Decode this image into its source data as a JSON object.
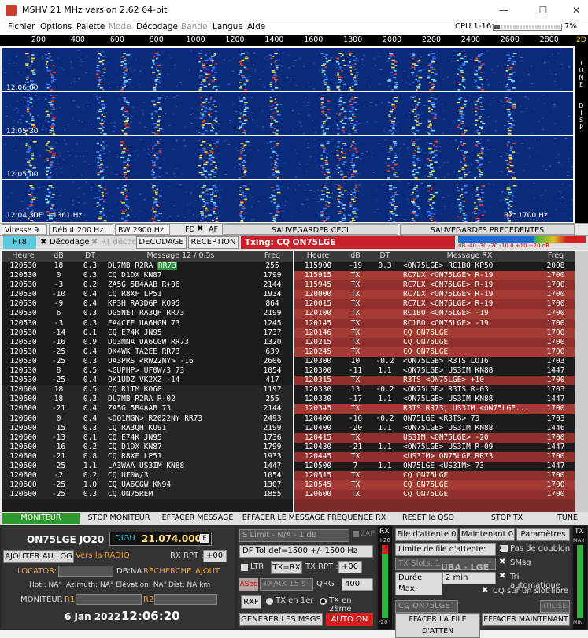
{
  "window": {
    "title": "MSHV 21 MHz version 2.62 64-bit",
    "minimize": "—",
    "maximize": "☐",
    "close": "✕"
  },
  "menu": {
    "items": [
      "Fichier",
      "Options",
      "Palette",
      "Mode",
      "Décodage",
      "Bande",
      "Langue",
      "Aide"
    ],
    "disabled": [
      "Mode",
      "Bande"
    ],
    "cpu_label": "CPU 1-16:",
    "cpu_value": "7%",
    "cpu_fraction": 0.07
  },
  "scale": {
    "ticks": [
      "200",
      "400",
      "600",
      "800",
      "1000",
      "1200",
      "1400",
      "1600",
      "1800",
      "2000",
      "2200",
      "2400",
      "2600",
      "2800",
      "3000"
    ],
    "side": "2D",
    "side_labels": [
      "T",
      "U",
      "N",
      "E",
      "D",
      "I",
      "S",
      "P"
    ]
  },
  "spectro": {
    "times": [
      "12:06:00",
      "12:05:30",
      "12:05:00",
      "12:04:30"
    ],
    "df": "DF: +1361 Hz",
    "rx": "RX: 1700 Hz"
  },
  "controls": {
    "vitesse": "Vitesse 9",
    "debut": "Début 200 Hz",
    "bw": "BW 2900 Hz",
    "fd": "FD",
    "af": "AF",
    "save_this": "SAUVEGARDER CECI",
    "save_prev": "SAUVEGARDES PRECEDENTES"
  },
  "modes": {
    "mode": "FT8",
    "decode_check": "Décodage",
    "rt": "RT décoc",
    "decodage": "DECODAGE",
    "reception": "RECEPTION",
    "txing": "Txing: CQ ON75LGE",
    "meter": "dB -40 -30 -20 -10 0 +10 +20 dB"
  },
  "left": {
    "headers": [
      "Heure",
      "dB",
      "DT",
      "Message 12 / 0.5s",
      "Freq"
    ],
    "rows": [
      [
        "120530",
        "18",
        "0.3",
        "DL7MB R2RA ",
        "RR73",
        "255"
      ],
      [
        "120530",
        "0",
        "0.3",
        "CQ D1DX KN87",
        "",
        "1799"
      ],
      [
        "120530",
        "-3",
        "0.2",
        "ZA5G 5B4AAB R+06",
        "",
        "2144"
      ],
      [
        "120530",
        "-10",
        "0.4",
        "CQ R8XF LP51",
        "",
        "1934"
      ],
      [
        "120530",
        "-9",
        "0.4",
        "KP3H RA3DGP KO95",
        "",
        "864"
      ],
      [
        "120530",
        "6",
        "0.3",
        "DG5NET RA3QH RR73",
        "",
        "2199"
      ],
      [
        "120530",
        "-3",
        "0.3",
        "EA4CFE UA6HGM 73",
        "",
        "1245"
      ],
      [
        "120530",
        "-14",
        "0.1",
        "CQ E74K JN95",
        "",
        "1737"
      ],
      [
        "120530",
        "-16",
        "0.9",
        "DO3MNA UA6CGW RR73",
        "",
        "1320"
      ],
      [
        "120530",
        "-25",
        "0.4",
        "DK4WK TA2EE RR73",
        "",
        "639"
      ],
      [
        "120530",
        "-25",
        "0.3",
        "UA3PRS <RW22NY> -16",
        "",
        "2606"
      ],
      [
        "120530",
        "8",
        "0.5",
        "<GUPHP> UF0W/3 73",
        "",
        "1054"
      ],
      [
        "120530",
        "-25",
        "0.4",
        "OK1UDZ VK2XZ -14",
        "",
        "417"
      ],
      [
        "120600",
        "18",
        "0.5",
        "CQ R1TM KO68",
        "",
        "1197"
      ],
      [
        "120600",
        "18",
        "0.3",
        "DL7MB R2RA R-02",
        "",
        "255"
      ],
      [
        "120600",
        "-21",
        "0.4",
        "ZA5G 5B4AAB 73",
        "",
        "2144"
      ],
      [
        "120600",
        "0",
        "0.4",
        "<DO1MGN> R2022NY RR73",
        "",
        "2493"
      ],
      [
        "120600",
        "-15",
        "0.3",
        "CQ RA3QH KO91",
        "",
        "2199"
      ],
      [
        "120600",
        "-13",
        "0.1",
        "CQ E74K JN95",
        "",
        "1736"
      ],
      [
        "120600",
        "-16",
        "0.2",
        "CQ D1DX KN87",
        "",
        "1799"
      ],
      [
        "120600",
        "-21",
        "0.8",
        "CQ R8XF LP51",
        "",
        "1933"
      ],
      [
        "120600",
        "-25",
        "1.1",
        "LA3WAA US3IM KN88",
        "",
        "1447"
      ],
      [
        "120600",
        "-2",
        "0.2",
        "CQ UF0W/3",
        "",
        "1054"
      ],
      [
        "120600",
        "-25",
        "1.0",
        "CQ UA6CGW KN94",
        "",
        "1307"
      ],
      [
        "120600",
        "-25",
        "0.3",
        "CQ ON75REM",
        "",
        "1855"
      ]
    ]
  },
  "right": {
    "headers": [
      "Heure",
      "dB",
      "DT",
      "Message RX",
      "Freq"
    ],
    "rows": [
      [
        "115900",
        "-19",
        "0.3",
        "<ON75LGE> RC1BO KP50",
        "2008"
      ],
      [
        "115915",
        "TX",
        "",
        "RC7LX <ON75LGE> R-19",
        "1700"
      ],
      [
        "115945",
        "TX",
        "",
        "RC7LX <ON75LGE> R-19",
        "1700"
      ],
      [
        "120000",
        "TX",
        "",
        "RC7LX <ON75LGE> R-19",
        "1700"
      ],
      [
        "120015",
        "TX",
        "",
        "RC7LX <ON75LGE> R-19",
        "1700"
      ],
      [
        "120100",
        "TX",
        "",
        "RC1BO <ON75LGE> -19",
        "1700"
      ],
      [
        "120145",
        "TX",
        "",
        "RC1BO <ON75LGE> -19",
        "1700"
      ],
      [
        "120146",
        "TX",
        "",
        "CQ ON75LGE",
        "1700"
      ],
      [
        "120215",
        "TX",
        "",
        "CQ ON75LGE",
        "1700"
      ],
      [
        "120245",
        "TX",
        "",
        "CQ ON75LGE",
        "1700"
      ],
      [
        "120300",
        "10",
        "-0.2",
        "<ON75LGE> R3TS LO16",
        "1703"
      ],
      [
        "120300",
        "-11",
        "1.1",
        "<ON75LGE> US3IM KN88",
        "1447"
      ],
      [
        "120315",
        "TX",
        "",
        "R3TS <ON75LGE> +10",
        "1700"
      ],
      [
        "120330",
        "13",
        "-0.2",
        "<ON75LGE> R3TS R-03",
        "1703"
      ],
      [
        "120330",
        "-17",
        "1.1",
        "<ON75LGE> US3IM KN88",
        "1447"
      ],
      [
        "120345",
        "TX",
        "",
        "R3TS RR73; US3IM <ON75LGE...",
        "1700"
      ],
      [
        "120400",
        "-16",
        "-0.2",
        "ON75LGE <R3TS> 73",
        "1703"
      ],
      [
        "120400",
        "-20",
        "1.1",
        "<ON75LGE> US3IM KN88",
        "1446"
      ],
      [
        "120415",
        "TX",
        "",
        "US3IM <ON75LGE> -20",
        "1700"
      ],
      [
        "120430",
        "-21",
        "1.1",
        "<ON75LGE> US3IM R-09",
        "1447"
      ],
      [
        "120445",
        "TX",
        "",
        "<US3IM> ON75LGE RR73",
        "1700"
      ],
      [
        "120500",
        "7",
        "1.1",
        "ON75LGE <US3IM> 73",
        "1447"
      ],
      [
        "120515",
        "TX",
        "",
        "CQ ON75LGE",
        "1700"
      ],
      [
        "120545",
        "TX",
        "",
        "CQ ON75LGE",
        "1700"
      ],
      [
        "120600",
        "TX",
        "",
        "CQ ON75LGE",
        "1700"
      ]
    ]
  },
  "bottom_buttons": [
    "MONITEUR",
    "STOP MONITEUR",
    "EFFACER MESSAGE",
    "EFFACER LE MESSAGE FREQUENCE RX",
    "RESET le QSO",
    "STOP TX",
    "TUNE"
  ],
  "station": {
    "call": "ON75LGE JO20",
    "digu": "DIGU",
    "freq": "21.074.000",
    "f_btn": "F",
    "log": "AJOUTER AU LOG",
    "vers": "Vers la RADIO",
    "rxrpt": "RX RPT :",
    "rxrpt_val": "+00",
    "locator": "LOCATOR:",
    "dbna": "DB:NA",
    "recherche": "RECHERCHE",
    "ajout": "AJOUT",
    "hot": "Hot : NA°",
    "az": "Azimuth: NA°",
    "el": "Elévation: NA°",
    "dist": "Dist: NA km",
    "moniteur": "MONITEUR",
    "r1": "R1:",
    "r2": "R2:",
    "date": "6 Jan 2022",
    "time": "12:06:20"
  },
  "mid": {
    "slimit": "S Limit - N/A - 1  dB",
    "zap": "ZAP",
    "dftol": "DF Tol def=1500 +/-  1500 Hz",
    "ltr": "LTR",
    "txrx": "TX=RX",
    "txrpt": "TX RPT :",
    "txrpt_val": "+00",
    "aseq": "ASeq",
    "txrx15": "TX/RX 15  s",
    "qrg": "QRG :",
    "qrg_val": "400",
    "rxf": "RXF",
    "tx1": "TX en 1er",
    "tx2": "TX en 2ème",
    "gen": "GENERER LES MSGS",
    "auto": "AUTO ON",
    "rx": "RX",
    "tx": "TX",
    "max": "MAX",
    "min": "MIN",
    "plus20": "+20",
    "minus20": "-20"
  },
  "queue": {
    "file": "File d'attente 0",
    "maint": "Maintenant 0",
    "params": "Paramètres",
    "limite": "Limite de file d'attente:",
    "limite_val": "2",
    "slots": "TX Slots: 1",
    "duree": "Durée Max:",
    "duree_val": "2 min",
    "cq": "CQ",
    "cqmsg": "CQ ON75LGE",
    "utilisee": "ITILISEI",
    "effacer_file": "FFACER LA FILE D'ATTEN",
    "effacer_maint": "EFFACER MAINTENANT",
    "pas": "Pas de doublon",
    "smsg": "SMsg",
    "tri": "Tri automatique",
    "cqslot": "CQ sur un slot libre",
    "wm": "UBA · LGE"
  }
}
